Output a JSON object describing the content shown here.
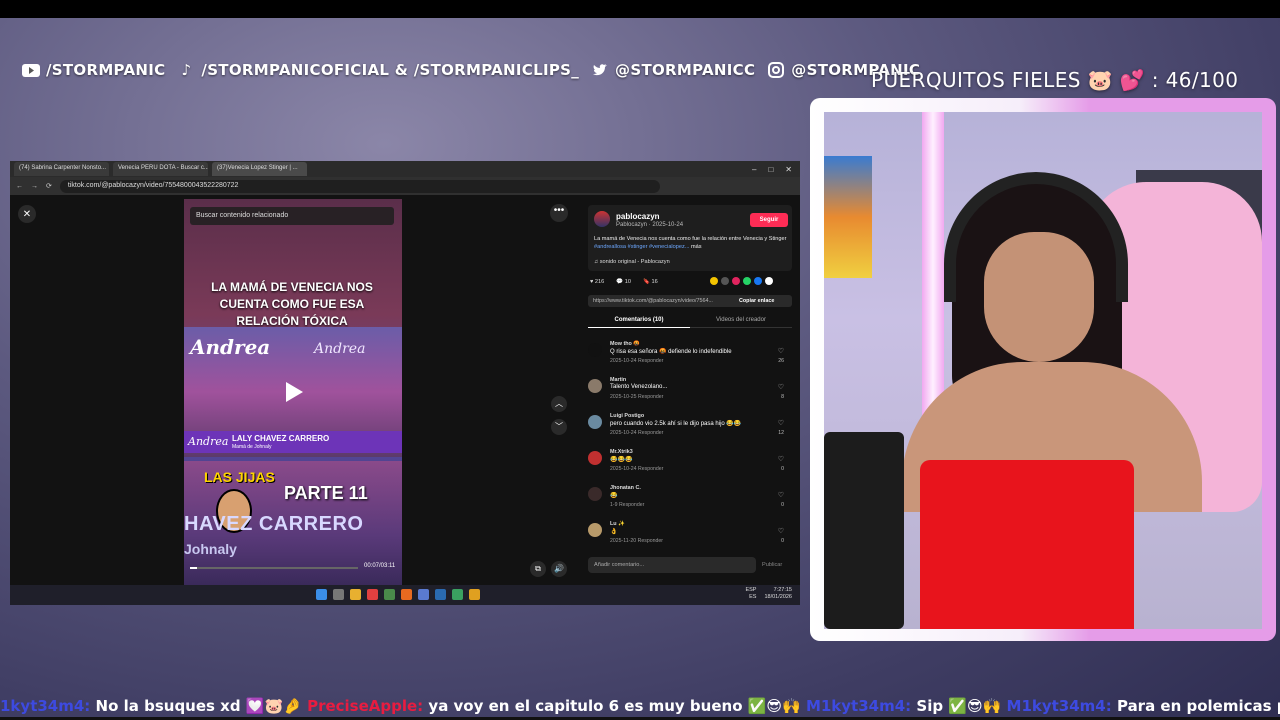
{
  "socials": {
    "youtube": "/STORMPANIC",
    "tiktok": "/STORMPANICOFICIAL & /STORMPANICLIPS_",
    "twitter": "@STORMPANICC",
    "instagram": "@STORMPANIC"
  },
  "goal": {
    "label": "PUERQUITOS FIELES",
    "emojis": "🐷 💕",
    "value": ": 46/100"
  },
  "browser": {
    "tabs": [
      "(74) Sabrina Carpenter Nonsto...",
      "Venecia PERU DOTA - Buscar c...",
      "(37)Venecia Lopez Stinger | ..."
    ],
    "url": "tiktok.com/@pablocazyn/video/7554800043522280722"
  },
  "video": {
    "search_placeholder": "Buscar contenido relacionado",
    "headline": "LA MAMÁ DE VENECIA NOS CUENTA COMO FUE ESA RELACIÓN TÓXICA",
    "brand": "Andrea",
    "lower_name": "LALY CHAVEZ CARRERO",
    "lower_sub": "Mamá de Johnaly",
    "clip2_tag": "LAS JIJAS",
    "clip2_part": "PARTE 11",
    "clip2_name": "HAVEZ CARRERO",
    "clip2_sub": "Johnaly",
    "time": "00:07/03:11",
    "progress": 0.04
  },
  "post": {
    "username": "pablocazyn",
    "meta": "Pablocazyn · 2025-10-24",
    "follow": "Seguir",
    "description": "La mamá de Venecia nos cuenta como fue la relación entre Venecia y Stinger ",
    "tags": "#andreallosa #stinger #venecialopez...",
    "more": " más",
    "sound": "♫ sonido original - Pablocazyn",
    "likes": "216",
    "comments_count": "10",
    "saves": "16",
    "link": "https://www.tiktok.com/@pablocazyn/video/7564...",
    "copy": "Copiar enlace",
    "tab_comments": "Comentarios (10)",
    "tab_videos": "Videos del creador",
    "add_comment": "Añadir comentario...",
    "publish": "Publicar"
  },
  "comments": [
    {
      "name": "Mow tho 🤬",
      "text": "Q risa esa señora 🤬 defiende lo indefendible",
      "meta": "2025-10-24    Responder",
      "count": "26"
    },
    {
      "name": "Martin",
      "text": "Talento Venezolano...",
      "meta": "2025-10-25    Responder",
      "count": "8"
    },
    {
      "name": "Luigi Postigo",
      "text": "pero cuando vio 2.5k ahí si le dijo pasa hijo 😂😂",
      "meta": "2025-10-24    Responder",
      "count": "12"
    },
    {
      "name": "Mr.Xtrik3",
      "text": "😂😂😂",
      "meta": "2025-10-24    Responder",
      "count": "0"
    },
    {
      "name": "Jhonatan C.",
      "text": "😂",
      "meta": "1-9    Responder",
      "count": "0"
    },
    {
      "name": "Lu ✨",
      "text": "👌",
      "meta": "2025-11-20    Responder",
      "count": "0"
    }
  ],
  "taskbar": {
    "lang": "ESP\nES",
    "time": "7:27:15",
    "date": "18/01/2026"
  },
  "chat": [
    {
      "user": "1kyt34m4:",
      "msg": " No la bsuques xd 💟🐷🤌 ",
      "style": "u1"
    },
    {
      "user": "PreciseApple:",
      "msg": " ya voy en el capitulo 6 es muy bueno ✅😎🙌 ",
      "style": "u2"
    },
    {
      "user": "M1kyt34m4:",
      "msg": " Sip ✅😎🙌 ",
      "style": "u1"
    },
    {
      "user": "M1kyt34m4:",
      "msg": " Para en polemicas ps",
      "style": "u1"
    }
  ],
  "colors": {
    "follow": "#fe2c55",
    "chat_user_blue": "#3d4ae0",
    "chat_user_red": "#e81c40",
    "goal_frame": "#e59ce8"
  }
}
